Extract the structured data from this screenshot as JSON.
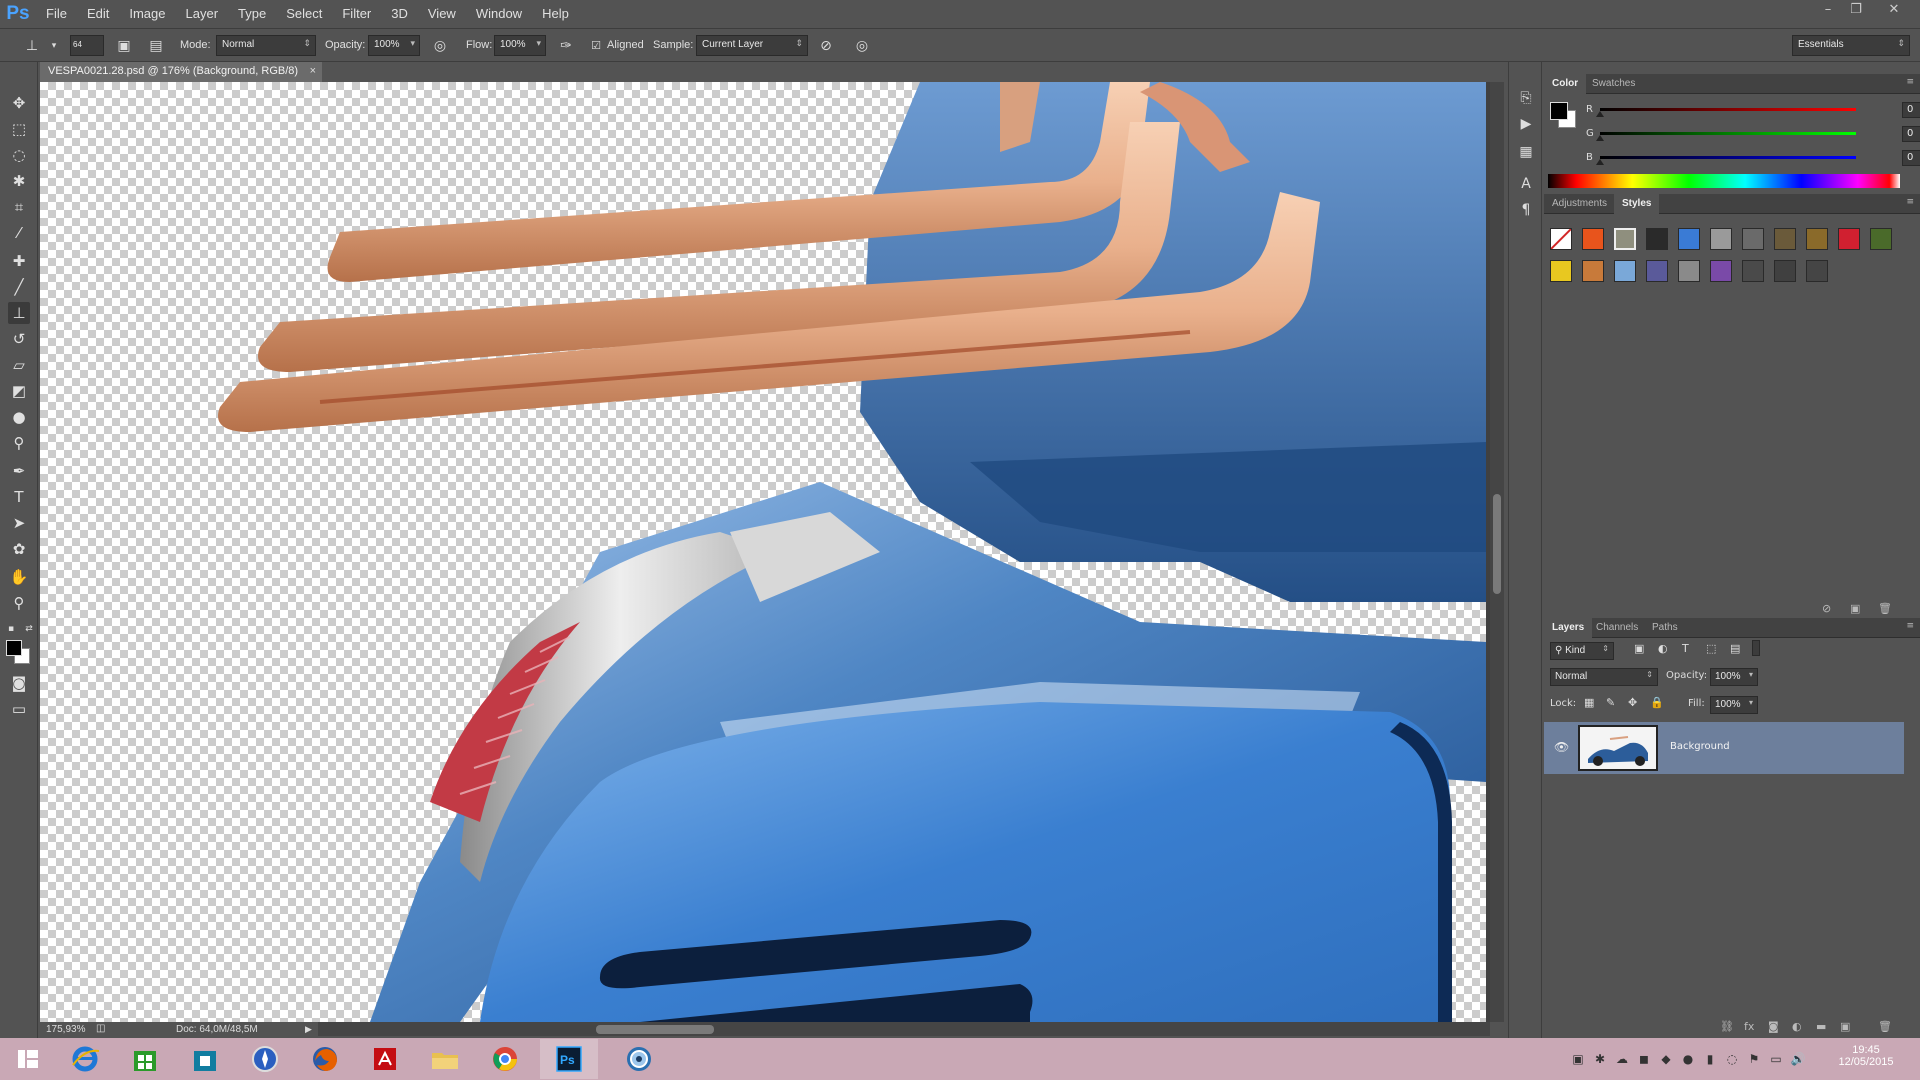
{
  "app": {
    "logo": "Ps"
  },
  "menu": [
    "File",
    "Edit",
    "Image",
    "Layer",
    "Type",
    "Select",
    "Filter",
    "3D",
    "View",
    "Window",
    "Help"
  ],
  "window_controls": {
    "minimize": "–",
    "restore": "❐",
    "close": "✕"
  },
  "options": {
    "brush_size": "64",
    "mode_label": "Mode:",
    "mode_value": "Normal",
    "opacity_label": "Opacity:",
    "opacity_value": "100%",
    "flow_label": "Flow:",
    "flow_value": "100%",
    "aligned_label": "Aligned",
    "aligned_checked": true,
    "sample_label": "Sample:",
    "sample_value": "Current Layer",
    "workspace": "Essentials"
  },
  "document": {
    "tab_title": "VESPA0021.28.psd @ 176% (Background, RGB/8)",
    "close": "×"
  },
  "status": {
    "zoom": "175,93%",
    "doc_info": "Doc: 64,0M/48,5M"
  },
  "color_panel": {
    "tabs": [
      "Color",
      "Swatches"
    ],
    "active_tab": "Color",
    "channels": [
      {
        "label": "R",
        "value": "0",
        "color": "#e02020"
      },
      {
        "label": "G",
        "value": "0",
        "color": "#20c020"
      },
      {
        "label": "B",
        "value": "0",
        "color": "#2030e0"
      }
    ],
    "foreground": "#000000",
    "background": "#ffffff"
  },
  "styles_panel": {
    "tabs": [
      "Adjustments",
      "Styles"
    ],
    "active_tab": "Styles",
    "swatches": [
      "#ffffff",
      "#e8541c",
      "#8f8f7e",
      "#2a2a2a",
      "#3a7bd5",
      "#9a9a9a",
      "#6a6a6a",
      "#6a5a3a",
      "#8a6a2a",
      "#d02030",
      "#4a6a2a",
      "#e8c820",
      "#c87a3a",
      "#7aa8d8",
      "#5a5a9a",
      "#8a8a8a",
      "#7a4aa8",
      "#4a4a4a",
      "#404040",
      "#454545"
    ]
  },
  "layers_panel": {
    "tabs": [
      "Layers",
      "Channels",
      "Paths"
    ],
    "active_tab": "Layers",
    "kind_label": "Kind",
    "blend_mode": "Normal",
    "opacity_label": "Opacity:",
    "opacity_value": "100%",
    "lock_label": "Lock:",
    "fill_label": "Fill:",
    "fill_value": "100%",
    "layers": [
      {
        "name": "Background",
        "visible": true
      }
    ]
  },
  "taskbar": {
    "apps": [
      "start",
      "internet-explorer",
      "store",
      "app-store",
      "safari",
      "firefox",
      "acrobat",
      "file-explorer",
      "chrome",
      "photoshop",
      "camera-raw"
    ],
    "time": "19:45",
    "date": "12/05/2015"
  }
}
